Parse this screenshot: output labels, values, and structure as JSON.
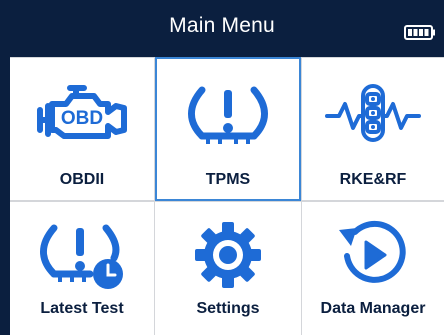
{
  "header": {
    "title": "Main Menu",
    "battery_icon": "battery-full-icon"
  },
  "colors": {
    "header_bg": "#0b1f3f",
    "icon_blue": "#1e6bd6",
    "label_text": "#0b1f3f",
    "selected_border": "#3b86d6"
  },
  "menu": {
    "items": [
      {
        "label": "OBDII",
        "icon": "obd-engine-icon",
        "selected": false
      },
      {
        "label": "TPMS",
        "icon": "tpms-warning-icon",
        "selected": true
      },
      {
        "label": "RKE&RF",
        "icon": "key-fob-signal-icon",
        "selected": false
      },
      {
        "label": "Latest Test",
        "icon": "tpms-clock-icon",
        "selected": false
      },
      {
        "label": "Settings",
        "icon": "gear-icon",
        "selected": false
      },
      {
        "label": "Data Manager",
        "icon": "playback-icon",
        "selected": false
      }
    ]
  }
}
